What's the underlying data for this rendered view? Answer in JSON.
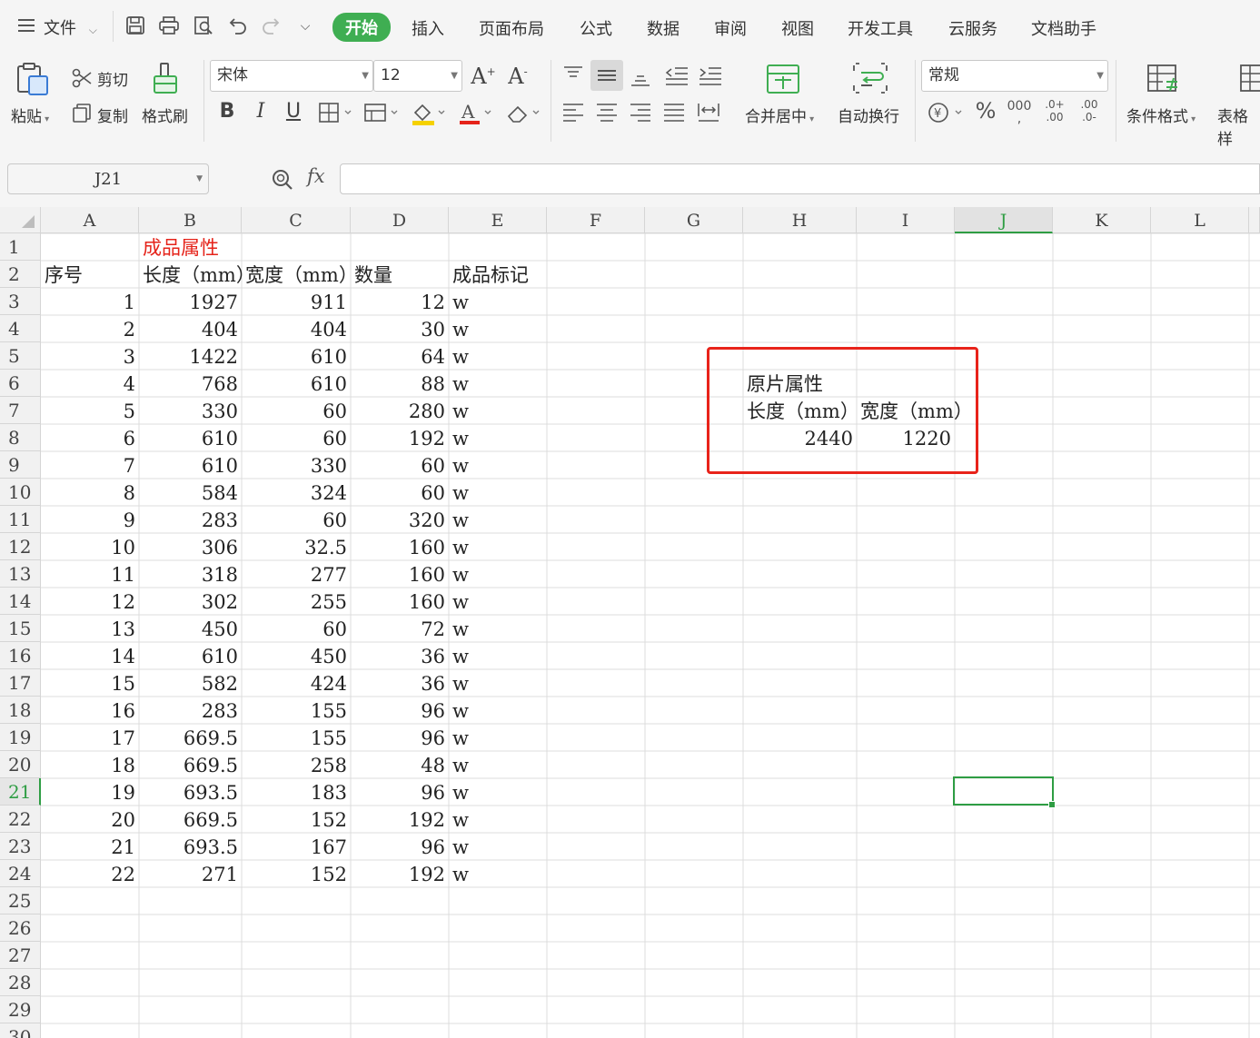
{
  "menubar": {
    "file_label": "文件",
    "tabs": [
      "开始",
      "插入",
      "页面布局",
      "公式",
      "数据",
      "审阅",
      "视图",
      "开发工具",
      "云服务",
      "文档助手"
    ]
  },
  "ribbon": {
    "paste": "粘贴",
    "cut": "剪切",
    "copy": "复制",
    "format_painter": "格式刷",
    "font_name": "宋体",
    "font_size": "12",
    "merge_center": "合并居中",
    "wrap_text": "自动换行",
    "number_format": "常规",
    "conditional_format": "条件格式",
    "table_style": "表格样"
  },
  "formula_bar": {
    "cell_ref": "J21",
    "fx": "fx",
    "content": ""
  },
  "grid": {
    "columns": [
      "A",
      "B",
      "C",
      "D",
      "E",
      "F",
      "G",
      "H",
      "I",
      "J",
      "K",
      "L"
    ],
    "rows": [
      "1",
      "2",
      "3",
      "4",
      "5",
      "6",
      "7",
      "8",
      "9",
      "10",
      "11",
      "12",
      "13",
      "14",
      "15",
      "16",
      "17",
      "18",
      "19",
      "20",
      "21",
      "22",
      "23",
      "24",
      "25",
      "26",
      "27",
      "28",
      "29",
      "30"
    ],
    "selected_cell": "J21",
    "title_b1": "成品属性",
    "headers": [
      "序号",
      "长度（mm）",
      "宽度（mm）",
      "数量",
      "成品标记"
    ],
    "data": [
      [
        "1",
        "1927",
        "911",
        "12",
        "w"
      ],
      [
        "2",
        "404",
        "404",
        "30",
        "w"
      ],
      [
        "3",
        "1422",
        "610",
        "64",
        "w"
      ],
      [
        "4",
        "768",
        "610",
        "88",
        "w"
      ],
      [
        "5",
        "330",
        "60",
        "280",
        "w"
      ],
      [
        "6",
        "610",
        "60",
        "192",
        "w"
      ],
      [
        "7",
        "610",
        "330",
        "60",
        "w"
      ],
      [
        "8",
        "584",
        "324",
        "60",
        "w"
      ],
      [
        "9",
        "283",
        "60",
        "320",
        "w"
      ],
      [
        "10",
        "306",
        "32.5",
        "160",
        "w"
      ],
      [
        "11",
        "318",
        "277",
        "160",
        "w"
      ],
      [
        "12",
        "302",
        "255",
        "160",
        "w"
      ],
      [
        "13",
        "450",
        "60",
        "72",
        "w"
      ],
      [
        "14",
        "610",
        "450",
        "36",
        "w"
      ],
      [
        "15",
        "582",
        "424",
        "36",
        "w"
      ],
      [
        "16",
        "283",
        "155",
        "96",
        "w"
      ],
      [
        "17",
        "669.5",
        "155",
        "96",
        "w"
      ],
      [
        "18",
        "669.5",
        "258",
        "48",
        "w"
      ],
      [
        "19",
        "693.5",
        "183",
        "96",
        "w"
      ],
      [
        "20",
        "669.5",
        "152",
        "192",
        "w"
      ],
      [
        "21",
        "693.5",
        "167",
        "96",
        "w"
      ],
      [
        "22",
        "271",
        "152",
        "192",
        "w"
      ]
    ],
    "raw_sheet": {
      "title": "原片属性",
      "length_label": "长度（mm）",
      "width_label": "宽度（mm）",
      "length": "2440",
      "width": "1220"
    }
  },
  "colors": {
    "accent": "#3fae52",
    "selection": "#2e9d43",
    "highlight_box": "#e8231a",
    "red_text": "#e5231a"
  }
}
